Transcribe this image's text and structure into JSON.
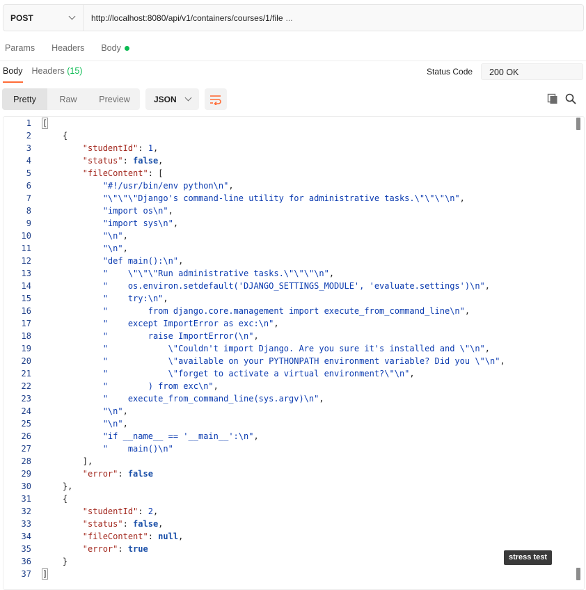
{
  "request": {
    "method": "POST",
    "url": "http://localhost:8080/api/v1/containers/courses/1/file",
    "url_ellipsis": "..."
  },
  "request_tabs": [
    {
      "label": "Params"
    },
    {
      "label": "Headers"
    },
    {
      "label": "Body",
      "indicator_color": "#0cbb52"
    }
  ],
  "response_tabs": {
    "body": "Body",
    "headers": "Headers",
    "headers_count": "(15)"
  },
  "status": {
    "label": "Status Code",
    "value": "200 OK"
  },
  "format": {
    "pretty": "Pretty",
    "raw": "Raw",
    "preview": "Preview",
    "language": "JSON"
  },
  "tooltip": "stress test",
  "colors": {
    "accent": "#ff6c37",
    "success": "#0cbb52",
    "key": "#a2271d",
    "string": "#0b3bb0"
  },
  "code_lines": [
    [
      [
        "p",
        "["
      ]
    ],
    [
      [
        "p",
        "    {"
      ]
    ],
    [
      [
        "p",
        "        "
      ],
      [
        "k",
        "\"studentId\""
      ],
      [
        "p",
        ": "
      ],
      [
        "n",
        "1"
      ],
      [
        "p",
        ","
      ]
    ],
    [
      [
        "p",
        "        "
      ],
      [
        "k",
        "\"status\""
      ],
      [
        "p",
        ": "
      ],
      [
        "b",
        "false"
      ],
      [
        "p",
        ","
      ]
    ],
    [
      [
        "p",
        "        "
      ],
      [
        "k",
        "\"fileContent\""
      ],
      [
        "p",
        ": ["
      ]
    ],
    [
      [
        "p",
        "            "
      ],
      [
        "s",
        "\"#!/usr/bin/env python\\n\""
      ],
      [
        "p",
        ","
      ]
    ],
    [
      [
        "p",
        "            "
      ],
      [
        "s",
        "\"\\\"\\\"\\\"Django's command-line utility for administrative tasks.\\\"\\\"\\\"\\n\""
      ],
      [
        "p",
        ","
      ]
    ],
    [
      [
        "p",
        "            "
      ],
      [
        "s",
        "\"import os\\n\""
      ],
      [
        "p",
        ","
      ]
    ],
    [
      [
        "p",
        "            "
      ],
      [
        "s",
        "\"import sys\\n\""
      ],
      [
        "p",
        ","
      ]
    ],
    [
      [
        "p",
        "            "
      ],
      [
        "s",
        "\"\\n\""
      ],
      [
        "p",
        ","
      ]
    ],
    [
      [
        "p",
        "            "
      ],
      [
        "s",
        "\"\\n\""
      ],
      [
        "p",
        ","
      ]
    ],
    [
      [
        "p",
        "            "
      ],
      [
        "s",
        "\"def main():\\n\""
      ],
      [
        "p",
        ","
      ]
    ],
    [
      [
        "p",
        "            "
      ],
      [
        "s",
        "\"    \\\"\\\"\\\"Run administrative tasks.\\\"\\\"\\\"\\n\""
      ],
      [
        "p",
        ","
      ]
    ],
    [
      [
        "p",
        "            "
      ],
      [
        "s",
        "\"    os.environ.setdefault('DJANGO_SETTINGS_MODULE', 'evaluate.settings')\\n\""
      ],
      [
        "p",
        ","
      ]
    ],
    [
      [
        "p",
        "            "
      ],
      [
        "s",
        "\"    try:\\n\""
      ],
      [
        "p",
        ","
      ]
    ],
    [
      [
        "p",
        "            "
      ],
      [
        "s",
        "\"        from django.core.management import execute_from_command_line\\n\""
      ],
      [
        "p",
        ","
      ]
    ],
    [
      [
        "p",
        "            "
      ],
      [
        "s",
        "\"    except ImportError as exc:\\n\""
      ],
      [
        "p",
        ","
      ]
    ],
    [
      [
        "p",
        "            "
      ],
      [
        "s",
        "\"        raise ImportError(\\n\""
      ],
      [
        "p",
        ","
      ]
    ],
    [
      [
        "p",
        "            "
      ],
      [
        "s",
        "\"            \\\"Couldn't import Django. Are you sure it's installed and \\\"\\n\""
      ],
      [
        "p",
        ","
      ]
    ],
    [
      [
        "p",
        "            "
      ],
      [
        "s",
        "\"            \\\"available on your PYTHONPATH environment variable? Did you \\\"\\n\""
      ],
      [
        "p",
        ","
      ]
    ],
    [
      [
        "p",
        "            "
      ],
      [
        "s",
        "\"            \\\"forget to activate a virtual environment?\\\"\\n\""
      ],
      [
        "p",
        ","
      ]
    ],
    [
      [
        "p",
        "            "
      ],
      [
        "s",
        "\"        ) from exc\\n\""
      ],
      [
        "p",
        ","
      ]
    ],
    [
      [
        "p",
        "            "
      ],
      [
        "s",
        "\"    execute_from_command_line(sys.argv)\\n\""
      ],
      [
        "p",
        ","
      ]
    ],
    [
      [
        "p",
        "            "
      ],
      [
        "s",
        "\"\\n\""
      ],
      [
        "p",
        ","
      ]
    ],
    [
      [
        "p",
        "            "
      ],
      [
        "s",
        "\"\\n\""
      ],
      [
        "p",
        ","
      ]
    ],
    [
      [
        "p",
        "            "
      ],
      [
        "s",
        "\"if __name__ == '__main__':\\n\""
      ],
      [
        "p",
        ","
      ]
    ],
    [
      [
        "p",
        "            "
      ],
      [
        "s",
        "\"    main()\\n\""
      ]
    ],
    [
      [
        "p",
        "        ],"
      ]
    ],
    [
      [
        "p",
        "        "
      ],
      [
        "k",
        "\"error\""
      ],
      [
        "p",
        ": "
      ],
      [
        "b",
        "false"
      ]
    ],
    [
      [
        "p",
        "    },"
      ]
    ],
    [
      [
        "p",
        "    {"
      ]
    ],
    [
      [
        "p",
        "        "
      ],
      [
        "k",
        "\"studentId\""
      ],
      [
        "p",
        ": "
      ],
      [
        "n",
        "2"
      ],
      [
        "p",
        ","
      ]
    ],
    [
      [
        "p",
        "        "
      ],
      [
        "k",
        "\"status\""
      ],
      [
        "p",
        ": "
      ],
      [
        "b",
        "false"
      ],
      [
        "p",
        ","
      ]
    ],
    [
      [
        "p",
        "        "
      ],
      [
        "k",
        "\"fileContent\""
      ],
      [
        "p",
        ": "
      ],
      [
        "b",
        "null"
      ],
      [
        "p",
        ","
      ]
    ],
    [
      [
        "p",
        "        "
      ],
      [
        "k",
        "\"error\""
      ],
      [
        "p",
        ": "
      ],
      [
        "b",
        "true"
      ]
    ],
    [
      [
        "p",
        "    }"
      ]
    ],
    [
      [
        "p",
        "]"
      ]
    ]
  ]
}
